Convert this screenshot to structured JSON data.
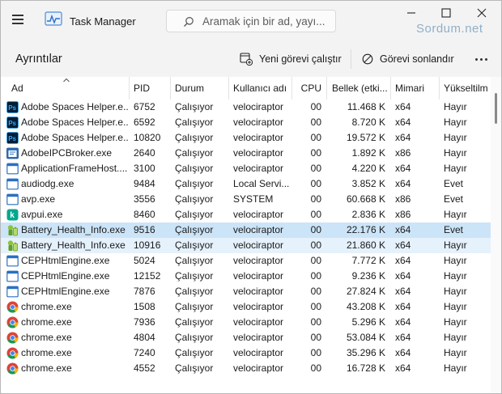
{
  "titlebar": {
    "app_title": "Task Manager",
    "menu_icon": "hamburger-menu-icon",
    "app_icon": "task-manager-icon",
    "search_placeholder": "Aramak için bir ad, yayı...",
    "watermark": "Sordum.net"
  },
  "window_controls": [
    "minimize-icon",
    "maximize-icon",
    "close-icon"
  ],
  "commandbar": {
    "page_title": "Ayrıntılar",
    "new_task_label": "Yeni görevi çalıştır",
    "end_task_label": "Görevi sonlandır",
    "more_icon": "more-options-icon"
  },
  "columns": {
    "name": "Ad",
    "pid": "PID",
    "status": "Durum",
    "user": "Kullanıcı adı",
    "cpu": "CPU",
    "memory": "Bellek (etki...",
    "arch": "Mimari",
    "elevated": "Yükseltilm"
  },
  "rows": [
    {
      "icon": "ps",
      "name": "Adobe Spaces Helper.e...",
      "pid": "6752",
      "status": "Çalışıyor",
      "user": "velociraptor",
      "cpu": "00",
      "memory": "11.468 K",
      "arch": "x64",
      "elevated": "Hayır"
    },
    {
      "icon": "ps",
      "name": "Adobe Spaces Helper.e...",
      "pid": "6592",
      "status": "Çalışıyor",
      "user": "velociraptor",
      "cpu": "00",
      "memory": "8.720 K",
      "arch": "x64",
      "elevated": "Hayır"
    },
    {
      "icon": "ps",
      "name": "Adobe Spaces Helper.e...",
      "pid": "10820",
      "status": "Çalışıyor",
      "user": "velociraptor",
      "cpu": "00",
      "memory": "19.572 K",
      "arch": "x64",
      "elevated": "Hayır"
    },
    {
      "icon": "broker",
      "name": "AdobeIPCBroker.exe",
      "pid": "2640",
      "status": "Çalışıyor",
      "user": "velociraptor",
      "cpu": "00",
      "memory": "1.892 K",
      "arch": "x86",
      "elevated": "Hayır"
    },
    {
      "icon": "app",
      "name": "ApplicationFrameHost....",
      "pid": "3100",
      "status": "Çalışıyor",
      "user": "velociraptor",
      "cpu": "00",
      "memory": "4.220 K",
      "arch": "x64",
      "elevated": "Hayır"
    },
    {
      "icon": "app",
      "name": "audiodg.exe",
      "pid": "9484",
      "status": "Çalışıyor",
      "user": "Local Servi...",
      "cpu": "00",
      "memory": "3.852 K",
      "arch": "x64",
      "elevated": "Evet"
    },
    {
      "icon": "app",
      "name": "avp.exe",
      "pid": "3556",
      "status": "Çalışıyor",
      "user": "SYSTEM",
      "cpu": "00",
      "memory": "60.668 K",
      "arch": "x86",
      "elevated": "Evet"
    },
    {
      "icon": "kaspersky",
      "name": "avpui.exe",
      "pid": "8460",
      "status": "Çalışıyor",
      "user": "velociraptor",
      "cpu": "00",
      "memory": "2.836 K",
      "arch": "x86",
      "elevated": "Hayır"
    },
    {
      "icon": "battery",
      "name": "Battery_Health_Info.exe",
      "pid": "9516",
      "status": "Çalışıyor",
      "user": "velociraptor",
      "cpu": "00",
      "memory": "22.176 K",
      "arch": "x64",
      "elevated": "Evet"
    },
    {
      "icon": "battery",
      "name": "Battery_Health_Info.exe",
      "pid": "10916",
      "status": "Çalışıyor",
      "user": "velociraptor",
      "cpu": "00",
      "memory": "21.860 K",
      "arch": "x64",
      "elevated": "Hayır"
    },
    {
      "icon": "app",
      "name": "CEPHtmlEngine.exe",
      "pid": "5024",
      "status": "Çalışıyor",
      "user": "velociraptor",
      "cpu": "00",
      "memory": "7.772 K",
      "arch": "x64",
      "elevated": "Hayır"
    },
    {
      "icon": "app",
      "name": "CEPHtmlEngine.exe",
      "pid": "12152",
      "status": "Çalışıyor",
      "user": "velociraptor",
      "cpu": "00",
      "memory": "9.236 K",
      "arch": "x64",
      "elevated": "Hayır"
    },
    {
      "icon": "app",
      "name": "CEPHtmlEngine.exe",
      "pid": "7876",
      "status": "Çalışıyor",
      "user": "velociraptor",
      "cpu": "00",
      "memory": "27.824 K",
      "arch": "x64",
      "elevated": "Hayır"
    },
    {
      "icon": "chrome",
      "name": "chrome.exe",
      "pid": "1508",
      "status": "Çalışıyor",
      "user": "velociraptor",
      "cpu": "00",
      "memory": "43.208 K",
      "arch": "x64",
      "elevated": "Hayır"
    },
    {
      "icon": "chrome",
      "name": "chrome.exe",
      "pid": "7936",
      "status": "Çalışıyor",
      "user": "velociraptor",
      "cpu": "00",
      "memory": "5.296 K",
      "arch": "x64",
      "elevated": "Hayır"
    },
    {
      "icon": "chrome",
      "name": "chrome.exe",
      "pid": "4804",
      "status": "Çalışıyor",
      "user": "velociraptor",
      "cpu": "00",
      "memory": "53.084 K",
      "arch": "x64",
      "elevated": "Hayır"
    },
    {
      "icon": "chrome",
      "name": "chrome.exe",
      "pid": "7240",
      "status": "Çalışıyor",
      "user": "velociraptor",
      "cpu": "00",
      "memory": "35.296 K",
      "arch": "x64",
      "elevated": "Hayır"
    },
    {
      "icon": "chrome",
      "name": "chrome.exe",
      "pid": "4552",
      "status": "Çalışıyor",
      "user": "velociraptor",
      "cpu": "00",
      "memory": "16.728 K",
      "arch": "x64",
      "elevated": "Hayır"
    }
  ],
  "selection": {
    "selected_row": 8,
    "highlighted_row": 9
  },
  "colors": {
    "selected": "#cce4f7",
    "highlighted": "#e5f1fb",
    "chrome_red": "#db4437",
    "ps_blue": "#001e36"
  }
}
